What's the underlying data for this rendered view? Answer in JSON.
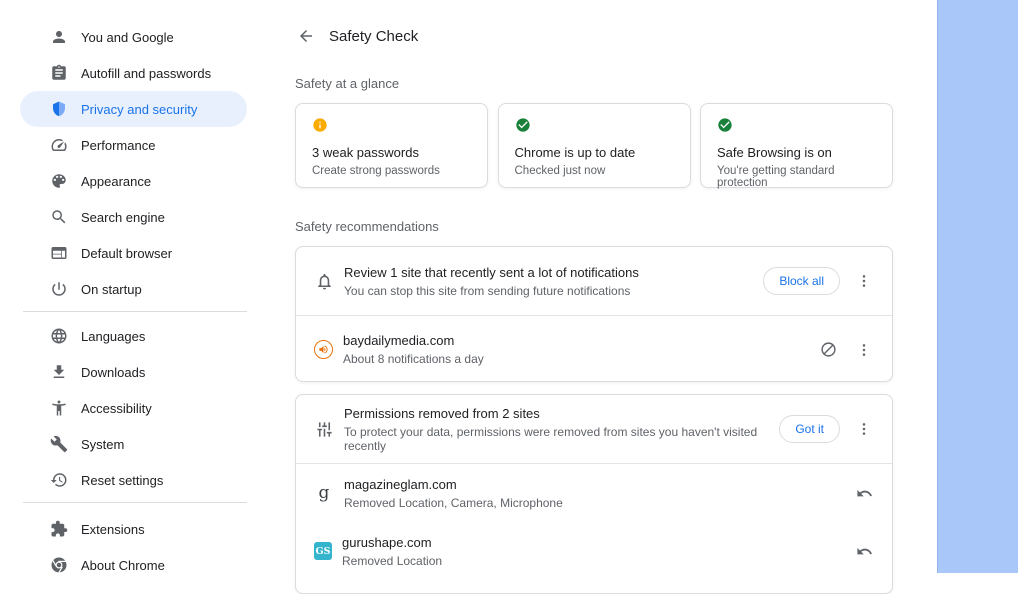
{
  "header": {
    "title": "Safety Check"
  },
  "sidebar": {
    "items": [
      {
        "label": "You and Google"
      },
      {
        "label": "Autofill and passwords"
      },
      {
        "label": "Privacy and security",
        "selected": true
      },
      {
        "label": "Performance"
      },
      {
        "label": "Appearance"
      },
      {
        "label": "Search engine"
      },
      {
        "label": "Default browser"
      },
      {
        "label": "On startup"
      },
      {
        "label": "Languages"
      },
      {
        "label": "Downloads"
      },
      {
        "label": "Accessibility"
      },
      {
        "label": "System"
      },
      {
        "label": "Reset settings"
      },
      {
        "label": "Extensions"
      },
      {
        "label": "About Chrome"
      }
    ]
  },
  "glance": {
    "section_label": "Safety at a glance",
    "cards": [
      {
        "icon": "info-icon",
        "title": "3 weak passwords",
        "subtitle": "Create strong passwords"
      },
      {
        "icon": "check-circle-icon",
        "title": "Chrome is up to date",
        "subtitle": "Checked just now"
      },
      {
        "icon": "check-circle-icon",
        "title": "Safe Browsing is on",
        "subtitle": "You're getting standard protection"
      }
    ]
  },
  "recommendations": {
    "section_label": "Safety recommendations",
    "notifications": {
      "title": "Review 1 site that recently sent a lot of notifications",
      "subtitle": "You can stop this site from sending future notifications",
      "action": "Block all",
      "sites": [
        {
          "domain": "baydailymedia.com",
          "detail": "About 8 notifications a day"
        }
      ]
    },
    "permissions": {
      "title": "Permissions removed from 2 sites",
      "subtitle": "To protect your data, permissions were removed from sites you haven't visited recently",
      "action": "Got it",
      "sites": [
        {
          "domain": "magazineglam.com",
          "detail": "Removed Location, Camera, Microphone",
          "favicon": "g"
        },
        {
          "domain": "gurushape.com",
          "detail": "Removed Location",
          "favicon": "GS"
        }
      ]
    }
  },
  "colors": {
    "accent": "#1a73e8",
    "warning": "#f9ab00",
    "success": "#188038",
    "favicon-orange": "#e8710a",
    "favicon-teal": "#35b5cd",
    "side-panel": "#a9c8f9"
  }
}
